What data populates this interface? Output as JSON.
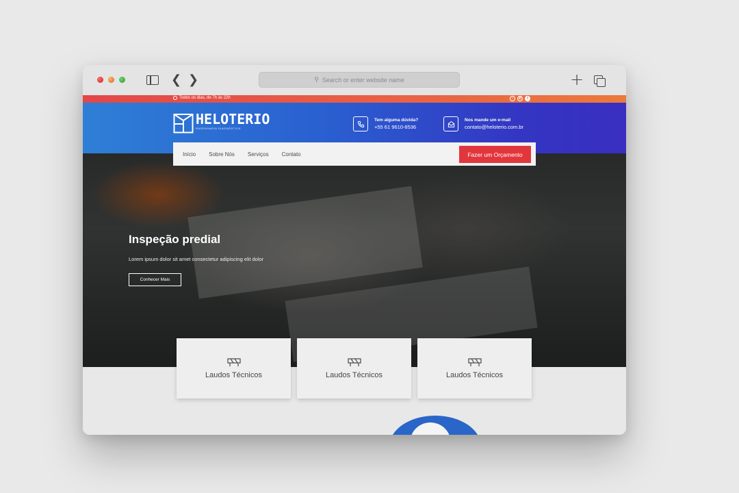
{
  "browser": {
    "address_placeholder": "Search or enter website name"
  },
  "topbar": {
    "hours": "Todos os dias, de 7h às 22h",
    "socials": [
      "instagram-icon",
      "whatsapp-icon",
      "facebook-icon"
    ]
  },
  "header": {
    "logo_name": "HELOTERIO",
    "logo_tagline": "ENGENHARIA DIAGNÓSTICA",
    "phone_label": "Tem alguma dúvida?",
    "phone_value": "+55 61 9610-8536",
    "mail_label": "Nos mande um e-mail",
    "mail_value": "contato@heloterio.com.br"
  },
  "nav": {
    "items": [
      "Início",
      "Sobre Nós",
      "Serviços",
      "Contato"
    ],
    "cta": "Fazer um Orçamento"
  },
  "hero": {
    "title": "Inspeção predial",
    "text": "Lorem ipsum dolor sit amet consectetur adipiscing elit dolor",
    "button": "Conhecer Mais"
  },
  "cards": [
    {
      "label": "Laudos Técnicos",
      "icon": "barrier-icon"
    },
    {
      "label": "Laudos Técnicos",
      "icon": "barrier-icon"
    },
    {
      "label": "Laudos Técnicos",
      "icon": "barrier-icon"
    }
  ],
  "colors": {
    "accent": "#e2363d",
    "header_start": "#2e7fd6",
    "header_end": "#3a2ec0"
  }
}
